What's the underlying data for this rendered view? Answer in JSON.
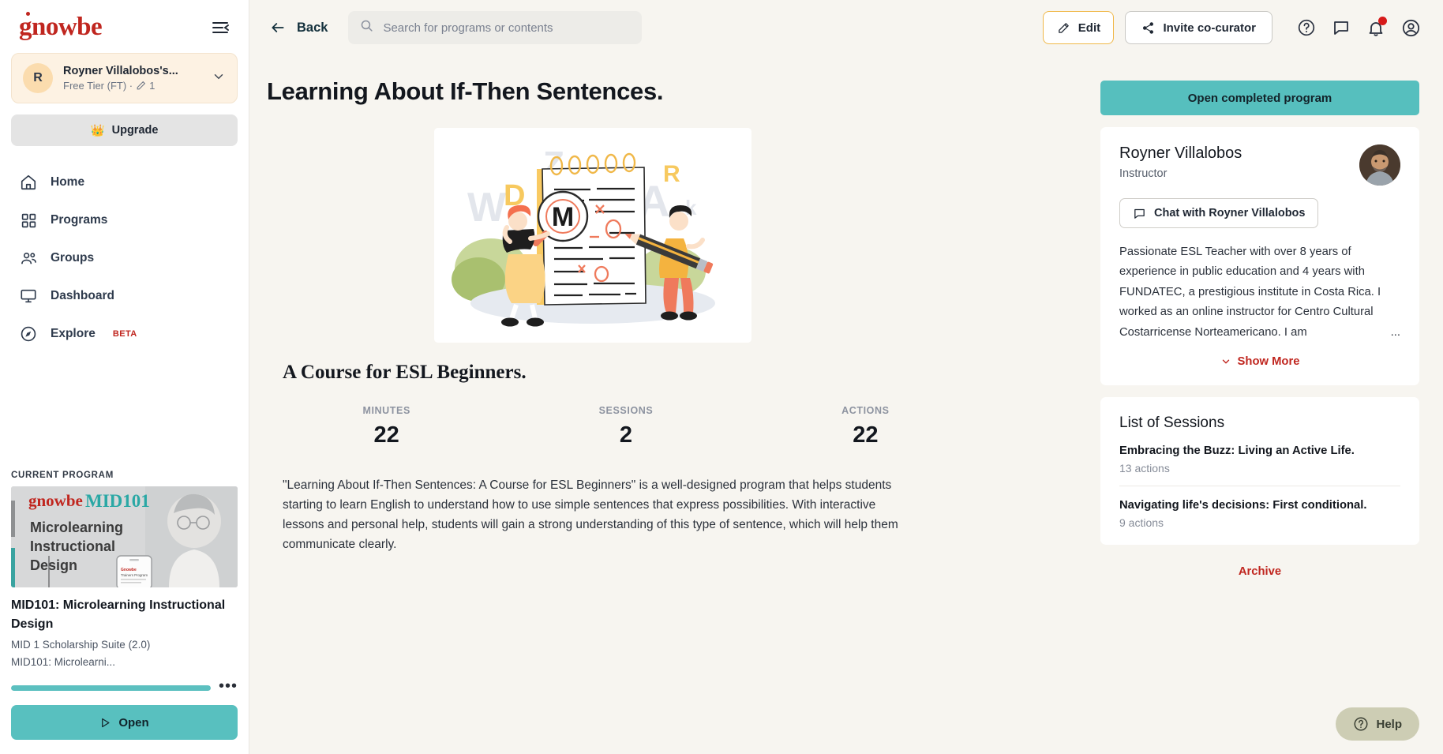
{
  "brand": {
    "name": "gnowbe"
  },
  "sidebar": {
    "account": {
      "initial": "R",
      "name": "Royner Villalobos's...",
      "subtitle": "Free Tier (FT) ·",
      "edit_count": "1"
    },
    "upgrade_label": "Upgrade",
    "nav": [
      {
        "label": "Home",
        "icon": "home-icon"
      },
      {
        "label": "Programs",
        "icon": "grid-icon"
      },
      {
        "label": "Groups",
        "icon": "people-icon"
      },
      {
        "label": "Dashboard",
        "icon": "monitor-icon"
      },
      {
        "label": "Explore",
        "icon": "compass-icon",
        "badge": "BETA"
      }
    ],
    "current_program": {
      "section_label": "CURRENT PROGRAM",
      "thumb_brand": "gnowbe",
      "thumb_code": "MID101",
      "thumb_title": "Microlearning Instructional Design",
      "title": "MID101: Microlearning Instructional Design",
      "meta_line1": "MID 1 Scholarship Suite (2.0)",
      "meta_line2": "MID101: Microlearni...",
      "progress_percent": 100,
      "more_label": "•••",
      "open_label": "Open"
    }
  },
  "topbar": {
    "back_label": "Back",
    "search_placeholder": "Search for programs or contents",
    "search_value": "",
    "edit_label": "Edit",
    "invite_label": "Invite co-curator",
    "icons": [
      "help-circle-icon",
      "chat-bubble-icon",
      "bell-icon",
      "account-circle-icon"
    ]
  },
  "main": {
    "title": "Learning About If-Then Sentences.",
    "subtitle": "A Course for ESL Beginners.",
    "stats": [
      {
        "label": "MINUTES",
        "value": "22"
      },
      {
        "label": "SESSIONS",
        "value": "2"
      },
      {
        "label": "ACTIONS",
        "value": "22"
      }
    ],
    "description": "\"Learning About If-Then Sentences: A Course for ESL Beginners\" is a well-designed program that helps students starting to learn English to understand how to use simple sentences that express possibilities. With interactive lessons and personal help, students will gain a strong understanding of this type of sentence, which will help them communicate clearly."
  },
  "right": {
    "open_completed_label": "Open completed program",
    "instructor": {
      "name": "Royner Villalobos",
      "role": "Instructor",
      "chat_label": "Chat with Royner Villalobos",
      "bio": "Passionate ESL Teacher with over 8 years of experience in public education and 4 years with FUNDATEC, a prestigious institute in Costa Rica. I worked as an online instructor for Centro Cultural Costarricense Norteamericano. I am",
      "bio_ellipsis": "...",
      "show_more_label": "Show More"
    },
    "sessions": {
      "title": "List of Sessions",
      "items": [
        {
          "name": "Embracing the Buzz: Living an Active Life.",
          "actions": "13 actions"
        },
        {
          "name": "Navigating life's decisions: First conditional.",
          "actions": "9 actions"
        }
      ]
    },
    "archive_label": "Archive"
  },
  "help_widget": {
    "label": "Help"
  },
  "colors": {
    "brand_red": "#c0261f",
    "teal": "#58c0bf",
    "accent_yellow": "#f0b849",
    "page_bg": "#f7f5f0"
  }
}
